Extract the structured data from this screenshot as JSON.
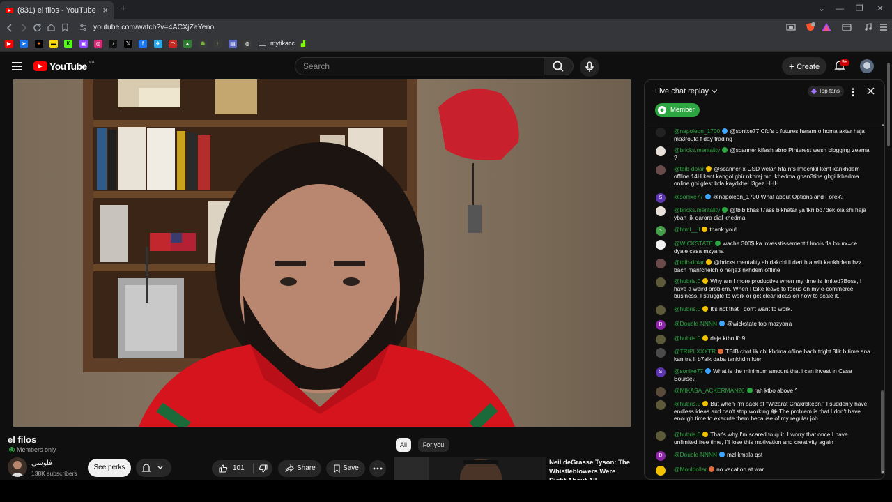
{
  "browser": {
    "tab_title": "(831) el filos - YouTube",
    "tab_close": "×",
    "new_tab": "+",
    "url": "youtube.com/watch?v=4ACXjZaYeno",
    "bookmark_folder": "mytikacc",
    "window_controls": [
      "⌄",
      "—",
      "❐",
      "✕"
    ]
  },
  "youtube": {
    "logo_text": "YouTube",
    "country_code": "MA",
    "search_placeholder": "Search",
    "create_label": "Create",
    "notification_count": "9+"
  },
  "video": {
    "title": "el filos",
    "members_only": "Members only",
    "channel_name": "فلوسي",
    "subscribers": "138K subscribers",
    "perks_label": "See perks",
    "like_count": "101",
    "share_label": "Share",
    "save_label": "Save"
  },
  "sidebar_tabs": {
    "all": "All",
    "for_you": "For you"
  },
  "recommendation": {
    "title": "Neil deGrasse Tyson: The Whistleblowers Were Right About All..."
  },
  "chat": {
    "mode": "Live chat replay",
    "top_fans": "Top fans",
    "member_filter": "Member",
    "messages": [
      {
        "author": "@napoleon_1700",
        "text": "@sonixe77 Cfd's o futures haram o homa aktar haja ma3roufa f day trading",
        "avatar": "",
        "avatar_color": "#222222",
        "badge_color": "#3ea6ff"
      },
      {
        "author": "@bricks.mentality",
        "text": "@scanner kifash abro Pinterest wesh blogging zeama ?",
        "avatar": "",
        "avatar_color": "#e8e0d8",
        "badge_color": "#2ba640"
      },
      {
        "author": "@tbib-dolar",
        "text": "@scanner-x-USD welah hta nfs lmochkil kent kankhdem offline 14H kent kangol ghir nkhrej mn lkhedma ghan3tiha ghgi lkhedma online ghi glest bda kaydkhel l3gez HHH",
        "avatar": "",
        "avatar_color": "#6b4a4a",
        "badge_color": "#f2c200"
      },
      {
        "author": "@sonixe77",
        "text": "@napoleon_1700 What about Options and Forex?",
        "avatar": "S",
        "avatar_color": "#5e35b1",
        "badge_color": "#3ea6ff"
      },
      {
        "author": "@bricks.mentality",
        "text": "@tbib khas t7ass blkhatar ya tkri bo7dek ola shi haja yban lik darora dial khedma",
        "avatar": "",
        "avatar_color": "#e8e0d8",
        "badge_color": "#2ba640"
      },
      {
        "author": "@html__ll",
        "text": "thank you!",
        "avatar": "s",
        "avatar_color": "#43a047",
        "badge_color": "#f2c200"
      },
      {
        "author": "@WICKSTATE",
        "text": "wache 300$ ka invesstissement f lmois fla bourx=ce dyale casa mzyana",
        "avatar": "",
        "avatar_color": "#f1f1f1",
        "badge_color": "#2ba640"
      },
      {
        "author": "@tbib-dolar",
        "text": "@bricks.mentality ah dakchi li dert hta wlit kankhdem bzz bach manfchelch o nerje3 nkhdem offline",
        "avatar": "",
        "avatar_color": "#6b4a4a",
        "badge_color": "#f2c200"
      },
      {
        "author": "@hubris.0",
        "text": "Why am I more productive when my time is limited?Boss, I have a weird problem. When I take leave to focus on my e-commerce business, I struggle to work or get clear ideas on how to scale it.",
        "avatar": "",
        "avatar_color": "#5d5a3a",
        "badge_color": "#f2c200"
      },
      {
        "author": "@hubris.0",
        "text": "It's not that I don't want to work.",
        "avatar": "",
        "avatar_color": "#5d5a3a",
        "badge_color": "#f2c200"
      },
      {
        "author": "@Double-NNNN",
        "text": "@wickstate top mazyana",
        "avatar": "D",
        "avatar_color": "#8e24aa",
        "badge_color": "#3ea6ff"
      },
      {
        "author": "@hubris.0",
        "text": "deja ktbo lfo9",
        "avatar": "",
        "avatar_color": "#5d5a3a",
        "badge_color": "#f2c200"
      },
      {
        "author": "@TRIPLXXXTR",
        "text": "TBIB chof lik chi khdma ofline bach tdght 3lik b time ana kan tra li b7alk daba tankhdm kter",
        "avatar": "",
        "avatar_color": "#4a4a4a",
        "badge_color": "#e06c3c"
      },
      {
        "author": "@sonixe77",
        "text": "What is the minimum amount that i can invest in Casa Bourse?",
        "avatar": "S",
        "avatar_color": "#5e35b1",
        "badge_color": "#3ea6ff"
      },
      {
        "author": "@MIKASA_ACKERMAN26",
        "text": "rah ktbo above ^",
        "avatar": "",
        "avatar_color": "#5a4a3a",
        "badge_color": "#2ba640"
      },
      {
        "author": "@hubris.0",
        "text": "But when I'm back at \"Wizarat Chakrbkebn,\" I suddenly have endless ideas and can't stop working 😂 The problem is that I don't have enough time to execute them because of my regular job.",
        "avatar": "",
        "avatar_color": "#5d5a3a",
        "badge_color": "#f2c200"
      },
      {
        "author": "@hubris.0",
        "text": "That's why I'm scared to quit. I worry that once I have unlimited free time, I'll lose this motivation and creativity again",
        "avatar": "",
        "avatar_color": "#5d5a3a",
        "badge_color": "#f2c200"
      },
      {
        "author": "@Double-NNNN",
        "text": "mzl kmala qst",
        "avatar": "D",
        "avatar_color": "#8e24aa",
        "badge_color": "#3ea6ff"
      },
      {
        "author": "@Mouldollar",
        "text": "no vacation at war",
        "avatar": "",
        "avatar_color": "#f2c200",
        "badge_color": "#e06c3c"
      }
    ]
  },
  "colors": {
    "youtube_red": "#ff0000",
    "member_green": "#2ba640",
    "background": "#0f0f0f"
  }
}
